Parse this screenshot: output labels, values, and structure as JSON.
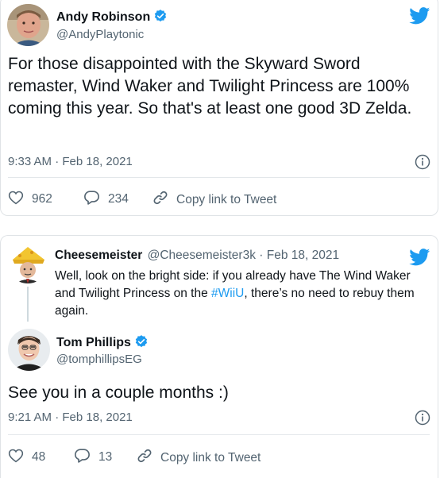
{
  "tweet1": {
    "author_name": "Andy Robinson",
    "author_handle": "@AndyPlaytonic",
    "text": "For those disappointed with the Skyward Sword remaster, Wind Waker and Twilight Princess are 100% coming this year. So that's at least one good 3D Zelda.",
    "timestamp": "9:33 AM · Feb 18, 2021",
    "like_count": "962",
    "reply_count": "234",
    "copy_link_label": "Copy link to Tweet"
  },
  "tweet2": {
    "quoted": {
      "author_name": "Cheesemeister",
      "author_handle": "@Cheesemeister3k · Feb 18, 2021",
      "text_before": "Well, look on the bright side: if you already have The Wind Waker and Twilight Princess on the ",
      "hashtag": "#WiiU",
      "text_after": ", there’s no need to rebuy them again."
    },
    "author_name": "Tom Phillips",
    "author_handle": "@tomphillipsEG",
    "text": "See you in a couple months :)",
    "timestamp": "9:21 AM · Feb 18, 2021",
    "like_count": "48",
    "reply_count": "13",
    "copy_link_label": "Copy link to Tweet"
  },
  "colors": {
    "twitter_blue": "#1d9bf0",
    "secondary_text": "#536471",
    "primary_text": "#0f1419"
  },
  "icons": [
    "twitter-bird-icon",
    "verified-badge-icon",
    "info-icon",
    "heart-icon",
    "reply-icon",
    "link-icon"
  ]
}
